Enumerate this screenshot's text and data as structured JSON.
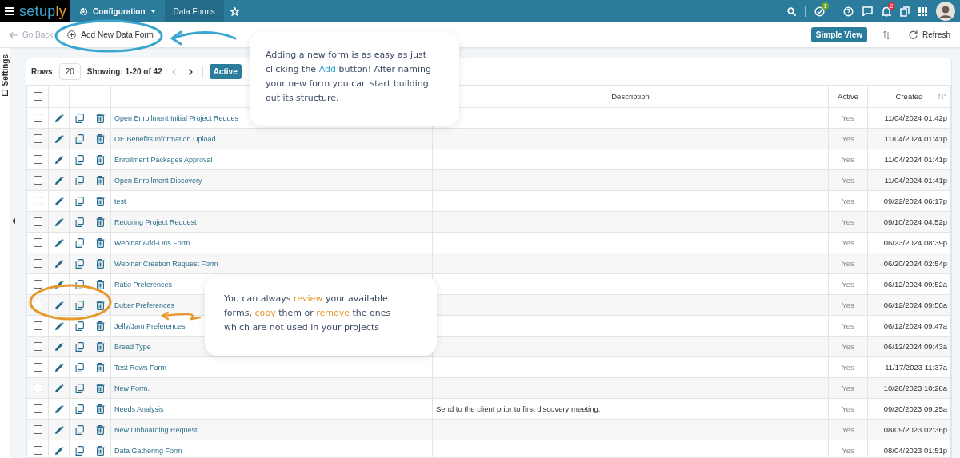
{
  "topbar": {
    "logo": "setup**ly**",
    "menu": [
      {
        "label": "Configuration",
        "kind": "dropdown",
        "selected": false
      },
      {
        "label": "Data Forms",
        "kind": "tab",
        "selected": true
      }
    ],
    "badges": {
      "tasks": "1",
      "notifications": "2"
    }
  },
  "subbar": {
    "back": "Go Back",
    "add": "Add New Data Form",
    "simple_view": "Simple View",
    "refresh": "Refresh"
  },
  "side_tab": "Settings",
  "toolbar": {
    "rows_label": "Rows",
    "rows_value": "20",
    "showing": "Showing: 1-20 of 42",
    "filter": {
      "label": "Active",
      "on": true
    }
  },
  "table": {
    "select_all_checked": false,
    "columns": [
      "Description",
      "Active",
      "Created"
    ],
    "rows": [
      {
        "name": "Open Enrollment Initial Project Reques",
        "description": "",
        "active": "Yes",
        "created": "11/04/2024 01:42p",
        "checked": false
      },
      {
        "name": "OE Benefits Information Upload",
        "description": "",
        "active": "Yes",
        "created": "11/04/2024 01:41p",
        "checked": false
      },
      {
        "name": "Enrollment Packages Approval",
        "description": "",
        "active": "Yes",
        "created": "11/04/2024 01:41p",
        "checked": false
      },
      {
        "name": "Open Enrollment Discovery",
        "description": "",
        "active": "Yes",
        "created": "11/04/2024 01:41p",
        "checked": false
      },
      {
        "name": "test",
        "description": "",
        "active": "Yes",
        "created": "09/22/2024 06:17p",
        "checked": false
      },
      {
        "name": "Recuring Project Request",
        "description": "",
        "active": "Yes",
        "created": "09/10/2024 04:52p",
        "checked": false
      },
      {
        "name": "Webinar Add-Ons Form",
        "description": "",
        "active": "Yes",
        "created": "06/23/2024 08:39p",
        "checked": false
      },
      {
        "name": "Webinar Creation Request Form",
        "description": "",
        "active": "Yes",
        "created": "06/20/2024 02:54p",
        "checked": false
      },
      {
        "name": "Ratio Preferences",
        "description": "",
        "active": "Yes",
        "created": "06/12/2024 09:52a",
        "checked": false
      },
      {
        "name": "Butter Preferences",
        "description": "",
        "active": "Yes",
        "created": "06/12/2024 09:50a",
        "checked": false
      },
      {
        "name": "Jelly/Jam Preferences",
        "description": "",
        "active": "Yes",
        "created": "06/12/2024 09:47a",
        "checked": false
      },
      {
        "name": "Bread Type",
        "description": "",
        "active": "Yes",
        "created": "06/12/2024 09:43a",
        "checked": false
      },
      {
        "name": "Test Rows Form",
        "description": "",
        "active": "Yes",
        "created": "11/17/2023 11:37a",
        "checked": false
      },
      {
        "name": "New Form.",
        "description": "",
        "active": "Yes",
        "created": "10/26/2023 10:28a",
        "checked": false
      },
      {
        "name": "Needs Analysis",
        "description": "Send to the client prior to first discovery meeting.",
        "active": "Yes",
        "created": "09/20/2023 09:25a",
        "checked": false
      },
      {
        "name": "New Onboarding Request",
        "description": "",
        "active": "Yes",
        "created": "08/09/2023 02:36p",
        "checked": false
      },
      {
        "name": "Data Gathering Form",
        "description": "",
        "active": "Yes",
        "created": "08/04/2023 01:51p",
        "checked": false
      }
    ]
  },
  "callouts": [
    {
      "text": "Adding a new form is as easy as just clicking the **Add** button! After naming your new form you can start building out its structure.",
      "color": "#3aa5cf"
    },
    {
      "text": "You can always **review** your available forms, **copy** them or **remove** the ones which are not used in your projects",
      "color": "#e69a2e"
    }
  ]
}
